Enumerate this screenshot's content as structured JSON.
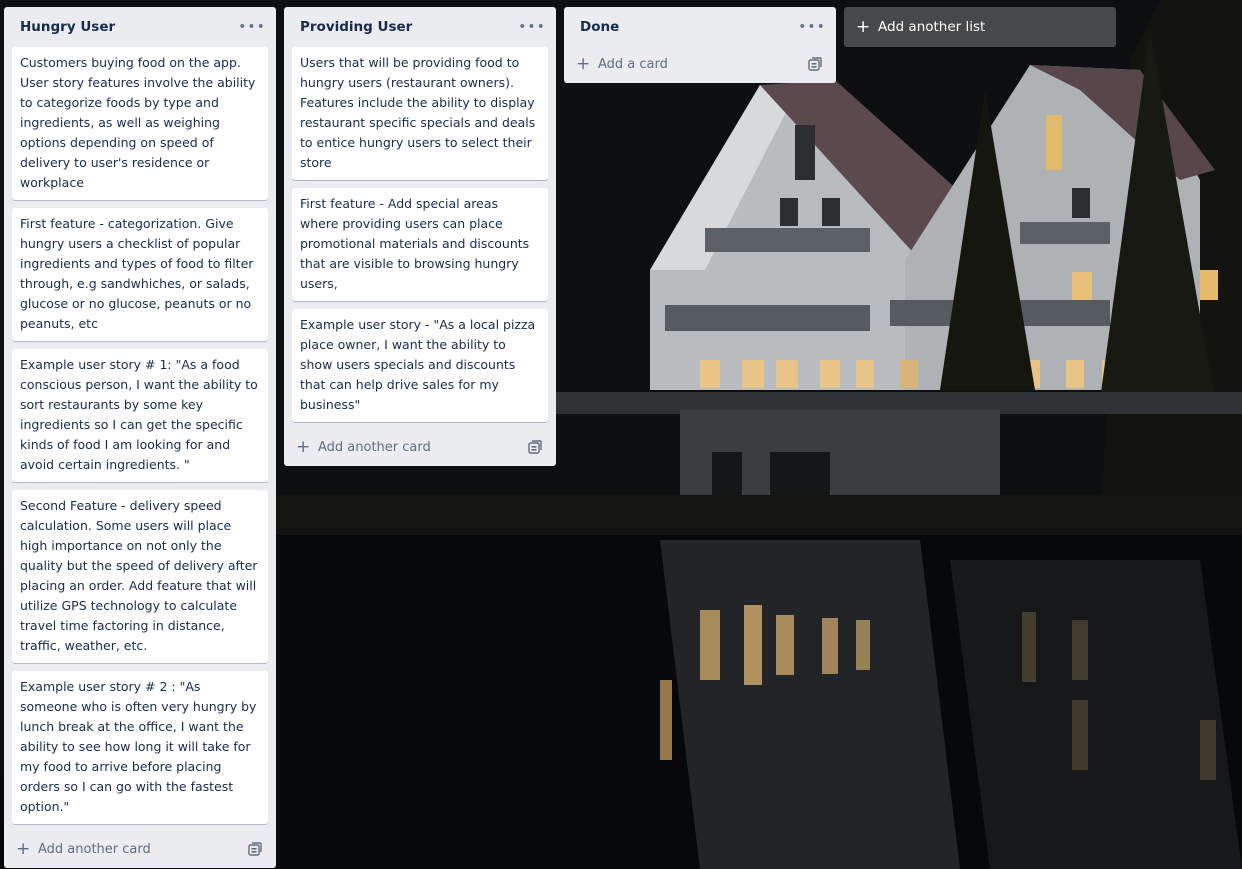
{
  "board": {
    "lists": [
      {
        "title": "Hungry User",
        "menu_icon": "ellipsis-icon",
        "cards": [
          "Customers buying food on the app. User story features involve the ability to categorize foods by type and ingredients, as well as weighing options depending on speed of delivery to user's residence or workplace",
          "First feature - categorization. Give hungry users a checklist of popular ingredients and types of food to filter through, e.g sandwhiches, or salads, glucose or no glucose, peanuts or no peanuts, etc",
          "Example user story # 1: \"As a food conscious person, I want the ability to sort restaurants by some key ingredients so I can get the specific kinds of food I am looking for and avoid certain ingredients. \"",
          "Second Feature - delivery speed calculation. Some users will place high importance on not only the quality but the speed of delivery after placing an order. Add feature that will utilize GPS technology to calculate travel time factoring in distance, traffic, weather, etc.",
          "Example user story # 2 : \"As someone who is often very hungry by lunch break at the office, I want the ability to see how long it will take for my food to arrive before placing orders so I can go with the fastest option.\""
        ],
        "add_label": "Add another card"
      },
      {
        "title": "Providing User",
        "menu_icon": "ellipsis-icon",
        "cards": [
          "Users that will be providing food to hungry users (restaurant owners). Features include the ability to display restaurant specific specials and deals to entice hungry users to select their store",
          "First feature - Add special areas where providing users can place promotional materials and discounts that are visible to browsing hungry users,",
          "Example user story - \"As a local pizza place owner, I want the ability to show users specials and discounts that can help drive sales for my business\""
        ],
        "add_label": "Add another card"
      },
      {
        "title": "Done",
        "menu_icon": "ellipsis-icon",
        "cards": [],
        "add_label": "Add a card"
      }
    ],
    "add_list_label": "Add another list"
  },
  "colors": {
    "list_bg": "#ebecf0",
    "card_text": "#172b4d",
    "muted_text": "#5e6c84"
  }
}
